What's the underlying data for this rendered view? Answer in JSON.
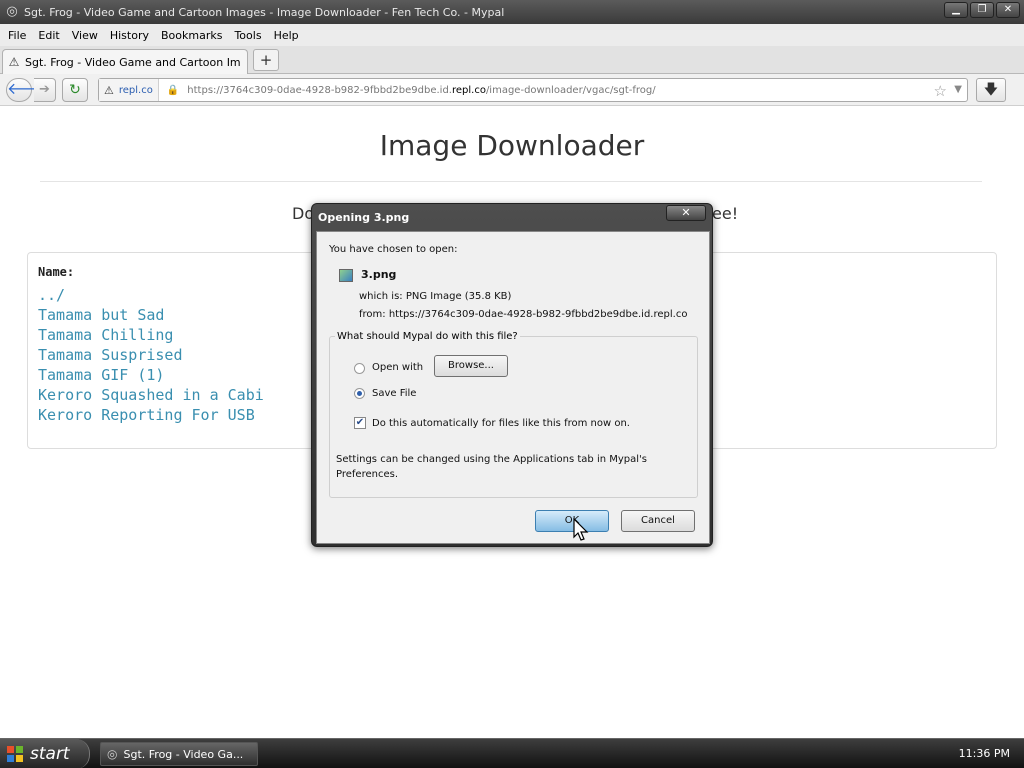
{
  "window": {
    "title": "Sgt. Frog - Video Game and Cartoon Images - Image Downloader - Fen Tech Co. - Mypal",
    "icon": "mypal-icon"
  },
  "menu": [
    "File",
    "Edit",
    "View",
    "History",
    "Bookmarks",
    "Tools",
    "Help"
  ],
  "tab": {
    "label": "Sgt. Frog - Video Game and Cartoon Images ..."
  },
  "nav": {
    "site_name": "repl.co",
    "url_prefix": "https://3764c309-0dae-4928-b982-9fbbd2be9dbe.id.",
    "url_host": "repl.co",
    "url_suffix": "/image-downloader/vgac/sgt-frog/"
  },
  "page": {
    "title": "Image Downloader",
    "subtitle_start": "Do",
    "subtitle_end": "ee!",
    "name_label": "Name:",
    "files": [
      "../",
      "Tamama but Sad",
      "Tamama Chilling",
      "Tamama Susprised",
      "Tamama GIF (1)",
      "Keroro Squashed in a Cabi",
      "Keroro Reporting For USB"
    ]
  },
  "dialog": {
    "title": "Opening 3.png",
    "close_label": "✕",
    "intro": "You have chosen to open:",
    "filename": "3.png",
    "which_is": "which is: PNG Image (35.8 KB)",
    "from": "from: https://3764c309-0dae-4928-b982-9fbbd2be9dbe.id.repl.co",
    "question": "What should Mypal do with this file?",
    "open_with_label": "Open with",
    "browse_label": "Browse...",
    "save_file_label": "Save File",
    "auto_label": "Do this automatically for files like this from now on.",
    "settings_note_1": "Settings can be changed using the Applications tab in Mypal's",
    "settings_note_2": "Preferences.",
    "ok_label": "OK",
    "cancel_label": "Cancel",
    "selected_option": "save-file",
    "auto_checked": true
  },
  "taskbar": {
    "start_label": "start",
    "task_label": "Sgt. Frog - Video Ga...",
    "clock": "11:36 PM"
  }
}
